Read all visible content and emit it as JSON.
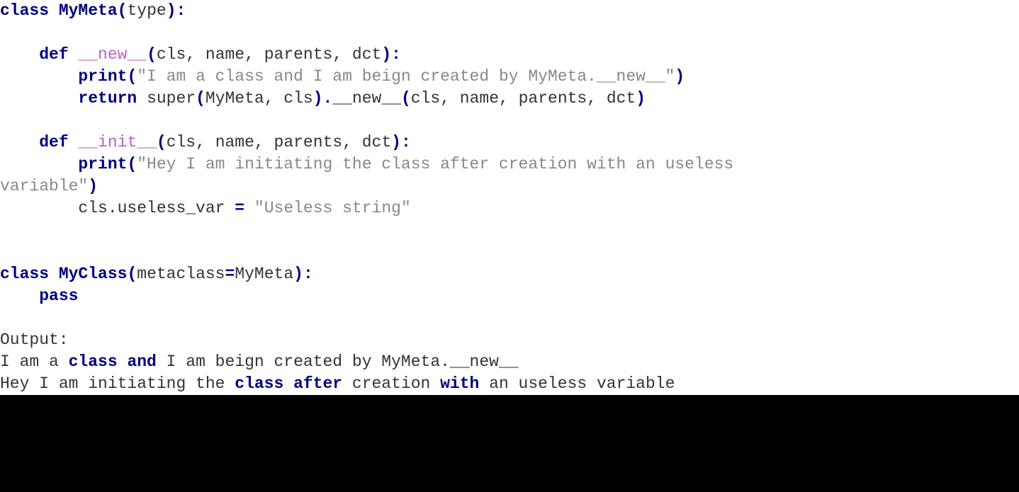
{
  "code": {
    "l1": {
      "kw_class": "class",
      "name": "MyMeta",
      "base": "type"
    },
    "l3": {
      "kw_def": "def",
      "dname": "__new__",
      "params": "cls, name, parents, dct"
    },
    "l4": {
      "fn": "print",
      "str": "\"I am a class and I am beign created by MyMeta.__new__\""
    },
    "l5": {
      "kw_return": "return",
      "super": "super",
      "args": "MyMeta, cls",
      "method": "__new__",
      "call": "cls, name, parents, dct"
    },
    "l7": {
      "kw_def": "def",
      "dname": "__init__",
      "params": "cls, name, parents, dct"
    },
    "l8": {
      "fn": "print",
      "str_a": "\"Hey I am initiating the class after creation with an useless ",
      "str_b": "variable\""
    },
    "l9": {
      "lhs": "cls.useless_var",
      "op": "=",
      "rhs": "\"Useless string\""
    },
    "l12": {
      "kw_class": "class",
      "name": "MyClass",
      "meta_kw": "metaclass",
      "op": "=",
      "meta_val": "MyMeta"
    },
    "l13": {
      "kw_pass": "pass"
    }
  },
  "output": {
    "label": "Output:",
    "line1": {
      "a": "I am a ",
      "b": "class and",
      "c": " I am beign created by MyMeta.__new__"
    },
    "line2": {
      "a": "Hey I am initiating the ",
      "b": "class after",
      "c": " creation ",
      "d": "with",
      "e": " an useless variable"
    }
  }
}
